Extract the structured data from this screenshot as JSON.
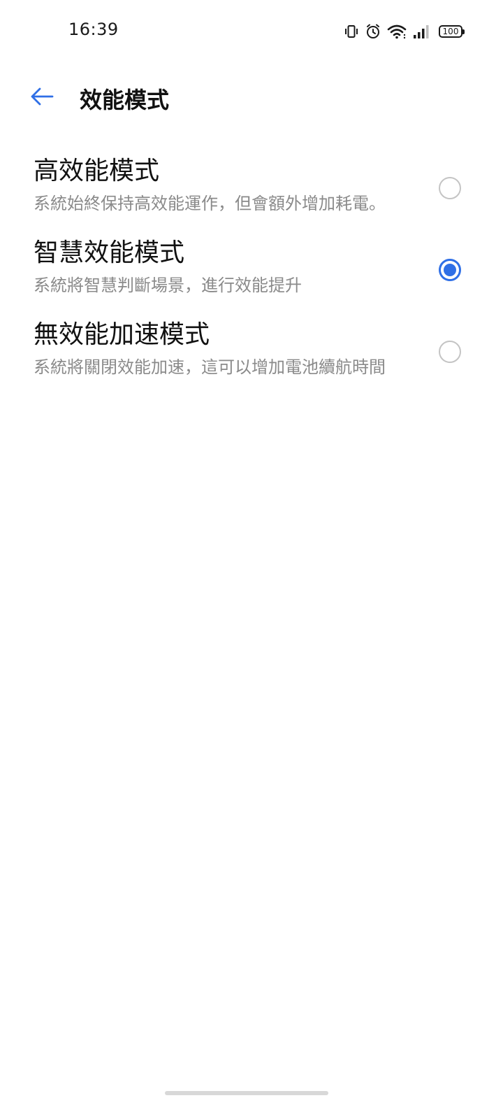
{
  "status_bar": {
    "time": "16:39",
    "battery": "100",
    "icons": [
      "vibrate-icon",
      "alarm-icon",
      "wifi-icon",
      "signal-icon",
      "battery-icon"
    ]
  },
  "header": {
    "title": "效能模式",
    "back_icon": "arrow-left-icon"
  },
  "options": [
    {
      "title": "高效能模式",
      "description": "系統始終保持高效能運作，但會額外增加耗電。",
      "selected": false
    },
    {
      "title": "智慧效能模式",
      "description": "系統將智慧判斷場景，進行效能提升",
      "selected": true
    },
    {
      "title": "無效能加速模式",
      "description": "系統將關閉效能加速，這可以增加電池續航時間",
      "selected": false
    }
  ],
  "colors": {
    "accent": "#2f6fe6",
    "title_text": "#111111",
    "description_text": "#8a8a8a",
    "radio_unselected": "#c4c4c4"
  }
}
